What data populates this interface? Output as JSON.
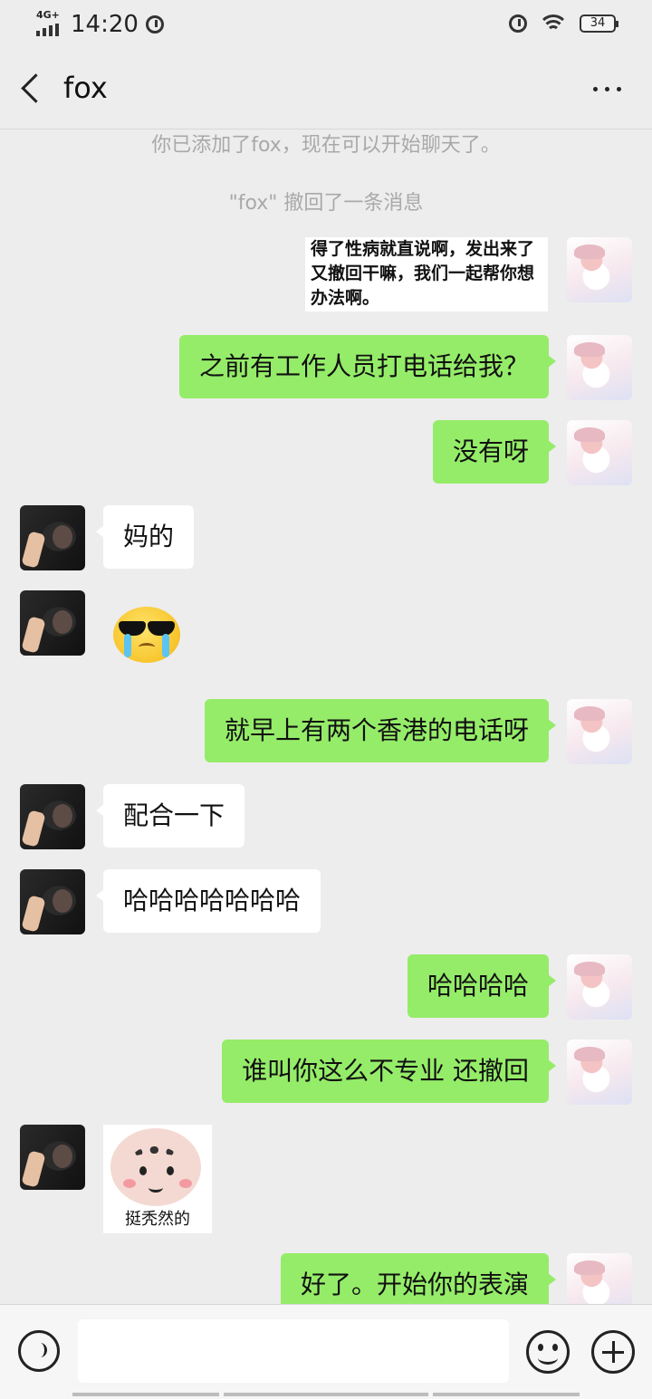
{
  "status_bar": {
    "network": "4G+",
    "time": "14:20",
    "battery": "34"
  },
  "header": {
    "title": "fox"
  },
  "system_messages": [
    "你已添加了fox，现在可以开始聊天了。",
    "\"fox\" 撤回了一条消息"
  ],
  "messages": [
    {
      "from": "me",
      "type": "image-text",
      "text": "得了性病就直说啊，发出来了又撤回干嘛，我们一起帮你想办法啊。"
    },
    {
      "from": "me",
      "type": "text",
      "text": "之前有工作人员打电话给我？"
    },
    {
      "from": "me",
      "type": "text",
      "text": "没有呀"
    },
    {
      "from": "fox",
      "type": "text",
      "text": "妈的"
    },
    {
      "from": "fox",
      "type": "emoji",
      "icon": "cool-crying-emoji"
    },
    {
      "from": "me",
      "type": "text",
      "text": "就早上有两个香港的电话呀"
    },
    {
      "from": "fox",
      "type": "text",
      "text": "配合一下"
    },
    {
      "from": "fox",
      "type": "text",
      "text": "哈哈哈哈哈哈哈"
    },
    {
      "from": "me",
      "type": "text",
      "text": "哈哈哈哈"
    },
    {
      "from": "me",
      "type": "text",
      "text": "谁叫你这么不专业 还撤回"
    },
    {
      "from": "fox",
      "type": "sticker",
      "caption": "挺秃然的"
    },
    {
      "from": "me",
      "type": "text",
      "text": "好了。开始你的表演"
    }
  ],
  "input_bar": {
    "voice": "voice-icon",
    "emoji": "smile-icon",
    "more": "plus-icon"
  },
  "colors": {
    "background": "#ededed",
    "my_bubble": "#95ec69",
    "their_bubble": "#ffffff"
  }
}
